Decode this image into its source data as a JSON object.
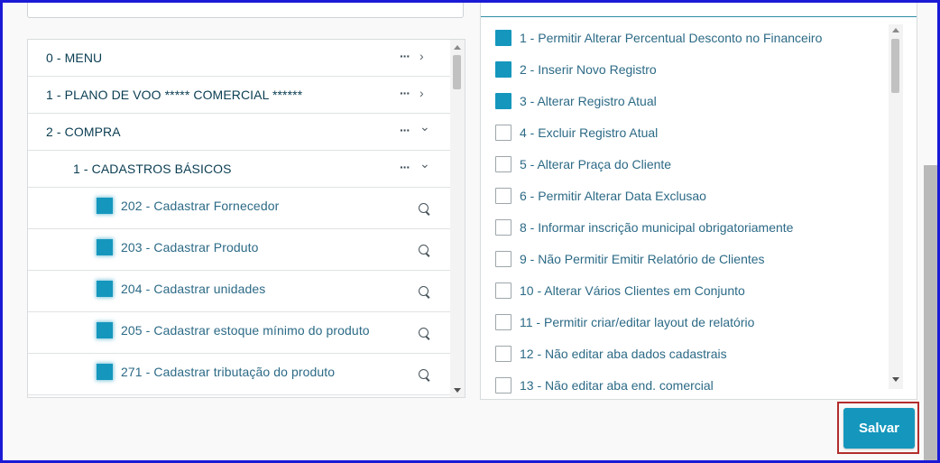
{
  "tree": {
    "rows": [
      {
        "label": "0 - MENU",
        "more": "···",
        "chevron": "›"
      },
      {
        "label": "1 - PLANO DE VOO ***** COMERCIAL ******",
        "more": "···",
        "chevron": "›"
      },
      {
        "label": "2 - COMPRA",
        "more": "···",
        "chevron": "⌄"
      },
      {
        "label": "1 - CADASTROS BÁSICOS",
        "more": "···",
        "chevron": "⌄"
      }
    ],
    "leaves": [
      {
        "label": "202 - Cadastrar Fornecedor",
        "checked": true
      },
      {
        "label": "203 - Cadastrar Produto",
        "checked": true
      },
      {
        "label": "204 - Cadastrar unidades",
        "checked": true
      },
      {
        "label": "205 - Cadastrar estoque mínimo do produto",
        "checked": true
      },
      {
        "label": "271 - Cadastrar tributação do produto",
        "checked": true
      }
    ]
  },
  "permissions": [
    {
      "label": "1 - Permitir Alterar Percentual Desconto no Financeiro",
      "checked": true
    },
    {
      "label": "2 - Inserir Novo Registro",
      "checked": true
    },
    {
      "label": "3 - Alterar Registro Atual",
      "checked": true
    },
    {
      "label": "4 - Excluir Registro Atual",
      "checked": false
    },
    {
      "label": "5 - Alterar Praça do Cliente",
      "checked": false
    },
    {
      "label": "6 - Permitir Alterar Data Exclusao",
      "checked": false
    },
    {
      "label": "8 - Informar inscrição municipal obrigatoriamente",
      "checked": false
    },
    {
      "label": "9 - Não Permitir Emitir Relatório de Clientes",
      "checked": false
    },
    {
      "label": "10 - Alterar Vários Clientes em Conjunto",
      "checked": false
    },
    {
      "label": "11 - Permitir criar/editar layout de relatório",
      "checked": false
    },
    {
      "label": "12 - Não editar aba dados cadastrais",
      "checked": false
    },
    {
      "label": "13 - Não editar aba end. comercial",
      "checked": false
    }
  ],
  "actions": {
    "save_label": "Salvar"
  },
  "colors": {
    "accent": "#1597bd",
    "text": "#2c6a86",
    "highlight_outline": "#b32d2d",
    "frame": "#1a1ad6"
  }
}
